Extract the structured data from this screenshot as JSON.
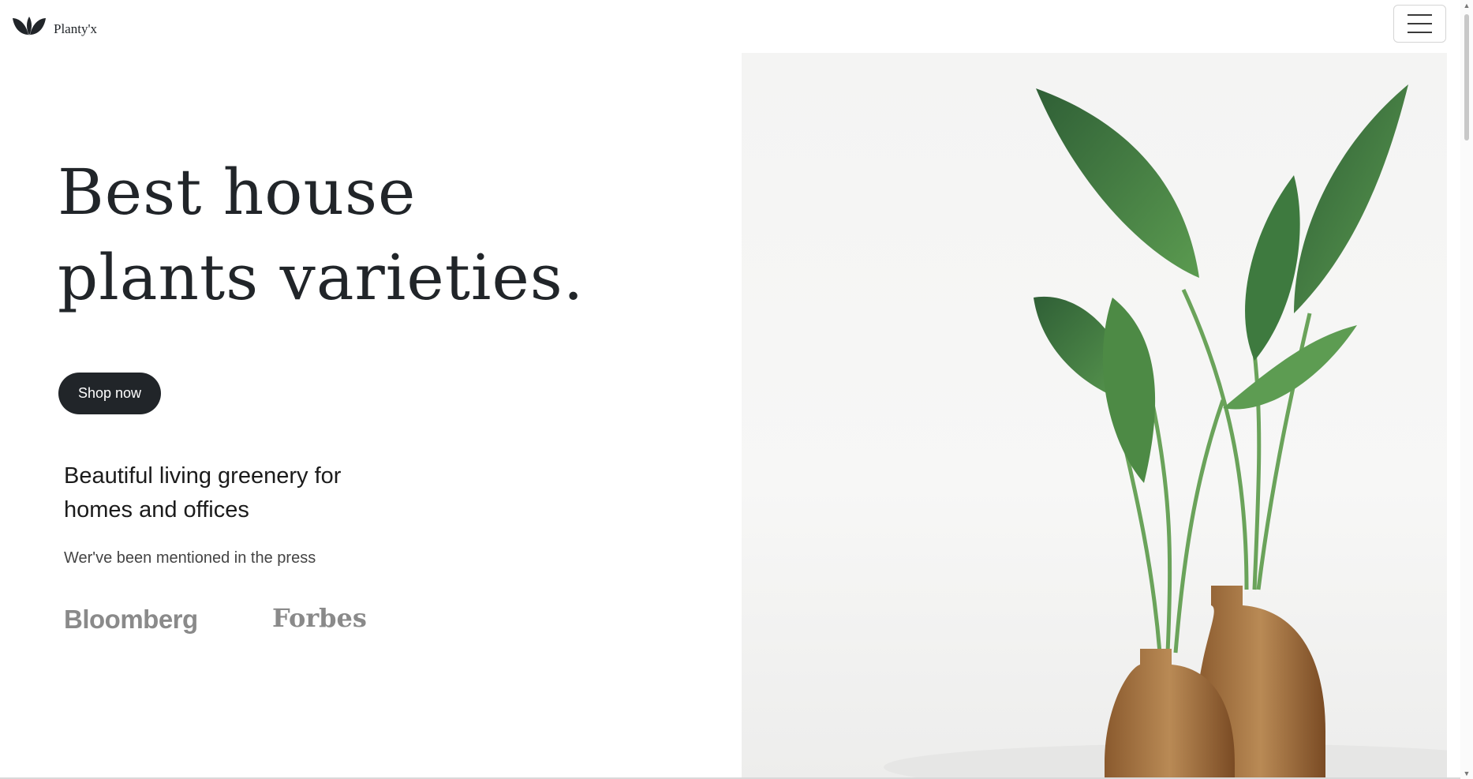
{
  "navbar": {
    "brand_name": "Planty'x",
    "menu_icon": "hamburger-menu-icon"
  },
  "hero": {
    "title_line1": "Best house",
    "title_line2": "plants varieties.",
    "cta_label": "Shop now",
    "subheading": "Beautiful living greenery for homes and offices",
    "press_text": "Wer've been mentioned in the press",
    "press_logos": [
      "Bloomberg",
      "Forbes"
    ]
  },
  "colors": {
    "primary_dark": "#212529",
    "logo_gray": "#8a8a8a",
    "leaf_green": "#3f7a43"
  }
}
